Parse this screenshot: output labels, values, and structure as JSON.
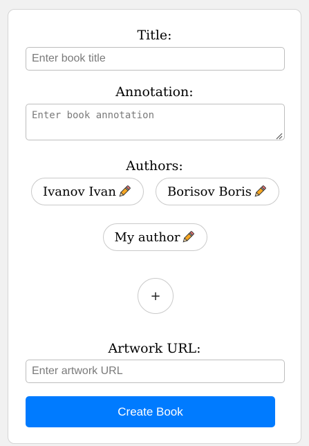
{
  "form": {
    "title": {
      "label": "Title:",
      "placeholder": "Enter book title",
      "value": ""
    },
    "annotation": {
      "label": "Annotation:",
      "placeholder": "Enter book annotation",
      "value": ""
    },
    "authors": {
      "label": "Authors:",
      "items": [
        {
          "name": "Ivanov Ivan",
          "edit_icon": "pencil-icon"
        },
        {
          "name": "Borisov Boris",
          "edit_icon": "pencil-icon"
        },
        {
          "name": "My author",
          "edit_icon": "pencil-icon"
        }
      ],
      "add_label": "+"
    },
    "artwork": {
      "label": "Artwork URL:",
      "placeholder": "Enter artwork URL",
      "value": ""
    },
    "submit_label": "Create Book"
  },
  "colors": {
    "primary_button": "#007bff",
    "pencil_body": "#f5a623",
    "page_background": "#f1f1f1",
    "card_background": "#ffffff"
  }
}
